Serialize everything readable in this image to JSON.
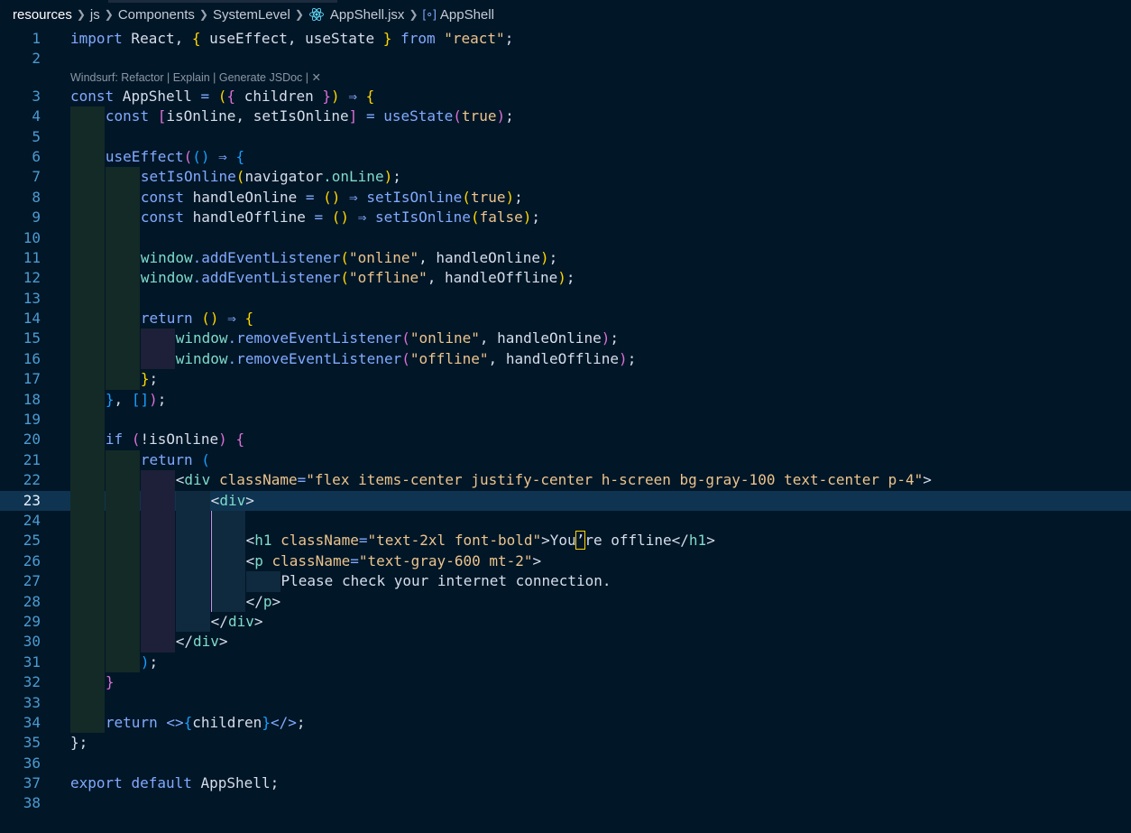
{
  "breadcrumb": {
    "segments": [
      "resources",
      "js",
      "Components",
      "SystemLevel",
      "AppShell.jsx",
      "AppShell"
    ]
  },
  "codelens": {
    "text": "Windsurf: Refactor | Explain | Generate JSDoc | ✕"
  },
  "editor": {
    "current_line": 23,
    "lines": [
      {
        "n": "1",
        "indent": 0,
        "tokens": [
          [
            "kw",
            "import"
          ],
          [
            "tx",
            " React, "
          ],
          [
            "p1",
            "{"
          ],
          [
            "tx",
            " useEffect, useState "
          ],
          [
            "p1",
            "}"
          ],
          [
            "tx",
            " "
          ],
          [
            "kw",
            "from"
          ],
          [
            "tx",
            " "
          ],
          [
            "str",
            "\"react\""
          ],
          [
            "tx",
            ";"
          ]
        ]
      },
      {
        "n": "2",
        "indent": 0,
        "tokens": []
      },
      {
        "lens": true
      },
      {
        "n": "3",
        "indent": 0,
        "tokens": [
          [
            "kw",
            "const"
          ],
          [
            "tx",
            " AppShell "
          ],
          [
            "op",
            "="
          ],
          [
            "tx",
            " "
          ],
          [
            "p1",
            "("
          ],
          [
            "p2",
            "{"
          ],
          [
            "tx",
            " children "
          ],
          [
            "p2",
            "}"
          ],
          [
            "p1",
            ")"
          ],
          [
            "tx",
            " "
          ],
          [
            "op",
            "⇒"
          ],
          [
            "tx",
            " "
          ],
          [
            "p1",
            "{"
          ]
        ]
      },
      {
        "n": "4",
        "indent": 1,
        "tokens": [
          [
            "kw",
            "const"
          ],
          [
            "tx",
            " "
          ],
          [
            "p2",
            "["
          ],
          [
            "tx",
            "isOnline, setIsOnline"
          ],
          [
            "p2",
            "]"
          ],
          [
            "tx",
            " "
          ],
          [
            "op",
            "="
          ],
          [
            "tx",
            " "
          ],
          [
            "fn",
            "useState"
          ],
          [
            "p2",
            "("
          ],
          [
            "bool",
            "true"
          ],
          [
            "p2",
            ")"
          ],
          [
            "tx",
            ";"
          ]
        ]
      },
      {
        "n": "5",
        "indent": 1,
        "tokens": []
      },
      {
        "n": "6",
        "indent": 1,
        "tokens": [
          [
            "fn",
            "useEffect"
          ],
          [
            "p2",
            "("
          ],
          [
            "p3",
            "()"
          ],
          [
            "tx",
            " "
          ],
          [
            "op",
            "⇒"
          ],
          [
            "tx",
            " "
          ],
          [
            "p3",
            "{"
          ]
        ]
      },
      {
        "n": "7",
        "indent": 2,
        "tokens": [
          [
            "fn",
            "setIsOnline"
          ],
          [
            "p1",
            "("
          ],
          [
            "tx",
            "navigator"
          ],
          [
            "prop",
            ".onLine"
          ],
          [
            "p1",
            ")"
          ],
          [
            "tx",
            ";"
          ]
        ]
      },
      {
        "n": "8",
        "indent": 2,
        "tokens": [
          [
            "kw",
            "const"
          ],
          [
            "tx",
            " handleOnline "
          ],
          [
            "op",
            "="
          ],
          [
            "tx",
            " "
          ],
          [
            "p1",
            "()"
          ],
          [
            "tx",
            " "
          ],
          [
            "op",
            "⇒"
          ],
          [
            "tx",
            " "
          ],
          [
            "fn",
            "setIsOnline"
          ],
          [
            "p1",
            "("
          ],
          [
            "bool",
            "true"
          ],
          [
            "p1",
            ")"
          ],
          [
            "tx",
            ";"
          ]
        ]
      },
      {
        "n": "9",
        "indent": 2,
        "tokens": [
          [
            "kw",
            "const"
          ],
          [
            "tx",
            " handleOffline "
          ],
          [
            "op",
            "="
          ],
          [
            "tx",
            " "
          ],
          [
            "p1",
            "()"
          ],
          [
            "tx",
            " "
          ],
          [
            "op",
            "⇒"
          ],
          [
            "tx",
            " "
          ],
          [
            "fn",
            "setIsOnline"
          ],
          [
            "p1",
            "("
          ],
          [
            "bool",
            "false"
          ],
          [
            "p1",
            ")"
          ],
          [
            "tx",
            ";"
          ]
        ]
      },
      {
        "n": "10",
        "indent": 2,
        "tokens": []
      },
      {
        "n": "11",
        "indent": 2,
        "tokens": [
          [
            "prop",
            "window"
          ],
          [
            "fn",
            ".addEventListener"
          ],
          [
            "p1",
            "("
          ],
          [
            "str",
            "\"online\""
          ],
          [
            "tx",
            ", handleOnline"
          ],
          [
            "p1",
            ")"
          ],
          [
            "tx",
            ";"
          ]
        ]
      },
      {
        "n": "12",
        "indent": 2,
        "tokens": [
          [
            "prop",
            "window"
          ],
          [
            "fn",
            ".addEventListener"
          ],
          [
            "p1",
            "("
          ],
          [
            "str",
            "\"offline\""
          ],
          [
            "tx",
            ", handleOffline"
          ],
          [
            "p1",
            ")"
          ],
          [
            "tx",
            ";"
          ]
        ]
      },
      {
        "n": "13",
        "indent": 2,
        "tokens": []
      },
      {
        "n": "14",
        "indent": 2,
        "tokens": [
          [
            "kw",
            "return"
          ],
          [
            "tx",
            " "
          ],
          [
            "p1",
            "()"
          ],
          [
            "tx",
            " "
          ],
          [
            "op",
            "⇒"
          ],
          [
            "tx",
            " "
          ],
          [
            "p1",
            "{"
          ]
        ]
      },
      {
        "n": "15",
        "indent": 3,
        "tokens": [
          [
            "prop",
            "window"
          ],
          [
            "fn",
            ".removeEventListener"
          ],
          [
            "p2",
            "("
          ],
          [
            "str",
            "\"online\""
          ],
          [
            "tx",
            ", handleOnline"
          ],
          [
            "p2",
            ")"
          ],
          [
            "tx",
            ";"
          ]
        ]
      },
      {
        "n": "16",
        "indent": 3,
        "tokens": [
          [
            "prop",
            "window"
          ],
          [
            "fn",
            ".removeEventListener"
          ],
          [
            "p2",
            "("
          ],
          [
            "str",
            "\"offline\""
          ],
          [
            "tx",
            ", handleOffline"
          ],
          [
            "p2",
            ")"
          ],
          [
            "tx",
            ";"
          ]
        ]
      },
      {
        "n": "17",
        "indent": 2,
        "tokens": [
          [
            "p1",
            "}"
          ],
          [
            "tx",
            ";"
          ]
        ]
      },
      {
        "n": "18",
        "indent": 1,
        "tokens": [
          [
            "p3",
            "}"
          ],
          [
            "tx",
            ", "
          ],
          [
            "p3",
            "[]"
          ],
          [
            "p2",
            ")"
          ],
          [
            "tx",
            ";"
          ]
        ]
      },
      {
        "n": "19",
        "indent": 1,
        "tokens": []
      },
      {
        "n": "20",
        "indent": 1,
        "tokens": [
          [
            "kw",
            "if"
          ],
          [
            "tx",
            " "
          ],
          [
            "p2",
            "("
          ],
          [
            "tx",
            "!isOnline"
          ],
          [
            "p2",
            ")"
          ],
          [
            "tx",
            " "
          ],
          [
            "p2",
            "{"
          ]
        ]
      },
      {
        "n": "21",
        "indent": 2,
        "tokens": [
          [
            "kw",
            "return"
          ],
          [
            "tx",
            " "
          ],
          [
            "p3",
            "("
          ]
        ]
      },
      {
        "n": "22",
        "indent": 3,
        "tokens": [
          [
            "tag",
            "<"
          ],
          [
            "tagc",
            "div"
          ],
          [
            "tx",
            " "
          ],
          [
            "attr",
            "className"
          ],
          [
            "op",
            "="
          ],
          [
            "str",
            "\"flex items-center justify-center h-screen bg-gray-100 text-center p-4\""
          ],
          [
            "tag",
            ">"
          ]
        ]
      },
      {
        "n": "23",
        "indent": 4,
        "tokens": [
          [
            "tag",
            "<"
          ],
          [
            "tagc",
            "div"
          ],
          [
            "tag",
            ">"
          ]
        ]
      },
      {
        "n": "24",
        "indent": 5,
        "tokens": []
      },
      {
        "n": "25",
        "indent": 5,
        "tokens": [
          [
            "tag",
            "<"
          ],
          [
            "tagc",
            "h1"
          ],
          [
            "tx",
            " "
          ],
          [
            "attr",
            "className"
          ],
          [
            "op",
            "="
          ],
          [
            "str",
            "\"text-2xl font-bold\""
          ],
          [
            "tag",
            ">"
          ],
          [
            "tx",
            "You"
          ],
          [
            "cur",
            "’"
          ],
          [
            "tx",
            "re offline"
          ],
          [
            "tag",
            "</"
          ],
          [
            "tagc",
            "h1"
          ],
          [
            "tag",
            ">"
          ]
        ]
      },
      {
        "n": "26",
        "indent": 5,
        "tokens": [
          [
            "tag",
            "<"
          ],
          [
            "tagc",
            "p"
          ],
          [
            "tx",
            " "
          ],
          [
            "attr",
            "className"
          ],
          [
            "op",
            "="
          ],
          [
            "str",
            "\"text-gray-600 mt-2\""
          ],
          [
            "tag",
            ">"
          ]
        ]
      },
      {
        "n": "27",
        "indent": 6,
        "tokens": [
          [
            "tx",
            "Please check your internet connection."
          ]
        ]
      },
      {
        "n": "28",
        "indent": 5,
        "tokens": [
          [
            "tag",
            "</"
          ],
          [
            "tagc",
            "p"
          ],
          [
            "tag",
            ">"
          ]
        ]
      },
      {
        "n": "29",
        "indent": 4,
        "tokens": [
          [
            "tag",
            "</"
          ],
          [
            "tagc",
            "div"
          ],
          [
            "tag",
            ">"
          ]
        ]
      },
      {
        "n": "30",
        "indent": 3,
        "tokens": [
          [
            "tag",
            "</"
          ],
          [
            "tagc",
            "div"
          ],
          [
            "tag",
            ">"
          ]
        ]
      },
      {
        "n": "31",
        "indent": 2,
        "tokens": [
          [
            "p3",
            ")"
          ],
          [
            "tx",
            ";"
          ]
        ]
      },
      {
        "n": "32",
        "indent": 1,
        "tokens": [
          [
            "p2",
            "}"
          ]
        ]
      },
      {
        "n": "33",
        "indent": 1,
        "tokens": []
      },
      {
        "n": "34",
        "indent": 1,
        "tokens": [
          [
            "kw",
            "return"
          ],
          [
            "tx",
            " "
          ],
          [
            "op",
            "<>"
          ],
          [
            "p3",
            "{"
          ],
          [
            "tx",
            "children"
          ],
          [
            "p3",
            "}"
          ],
          [
            "op",
            "</>"
          ],
          [
            "tx",
            ";"
          ]
        ]
      },
      {
        "n": "35",
        "indent": 0,
        "tokens": [
          [
            "tx",
            "};"
          ]
        ]
      },
      {
        "n": "36",
        "indent": 0,
        "tokens": []
      },
      {
        "n": "37",
        "indent": 0,
        "tokens": [
          [
            "kw",
            "export"
          ],
          [
            "tx",
            " "
          ],
          [
            "kw",
            "default"
          ],
          [
            "tx",
            " AppShell;"
          ]
        ]
      },
      {
        "n": "38",
        "indent": 0,
        "tokens": []
      }
    ]
  }
}
